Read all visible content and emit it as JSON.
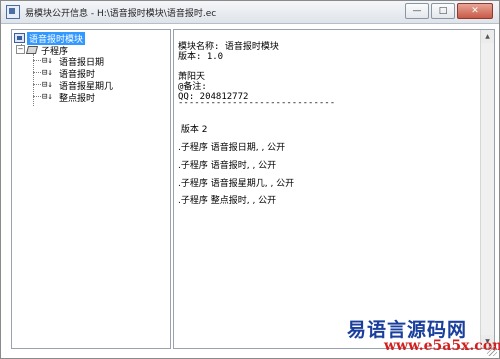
{
  "window": {
    "title": "易模块公开信息 - H:\\语音报时模块\\语音报时.ec",
    "minimize_glyph": "—",
    "maximize_glyph": "□",
    "close_glyph": "✕"
  },
  "tree": {
    "root_label": "语音报时模块",
    "group_label": "子程序",
    "items": [
      {
        "label": "语音报日期",
        "icon": "function-icon"
      },
      {
        "label": "语音报时",
        "icon": "function-icon"
      },
      {
        "label": "语音报星期几",
        "icon": "function-icon"
      },
      {
        "label": "整点报时",
        "icon": "function-icon"
      }
    ]
  },
  "info": {
    "lines": [
      "模块名称: 语音报时模块",
      "版本: 1.0",
      "",
      "萧阳天",
      "@备注:",
      "QQ: 204812772"
    ],
    "separator": "-----------------------------",
    "content": [
      " 版本 2",
      ".子程序 语音报日期, , 公开",
      ".子程序 语音报时, , 公开",
      ".子程序 语音报星期几, , 公开",
      ".子程序 整点报时, , 公开"
    ]
  },
  "watermark": {
    "line1": "易语言源码网",
    "line2": "www.e5a5x.com"
  }
}
